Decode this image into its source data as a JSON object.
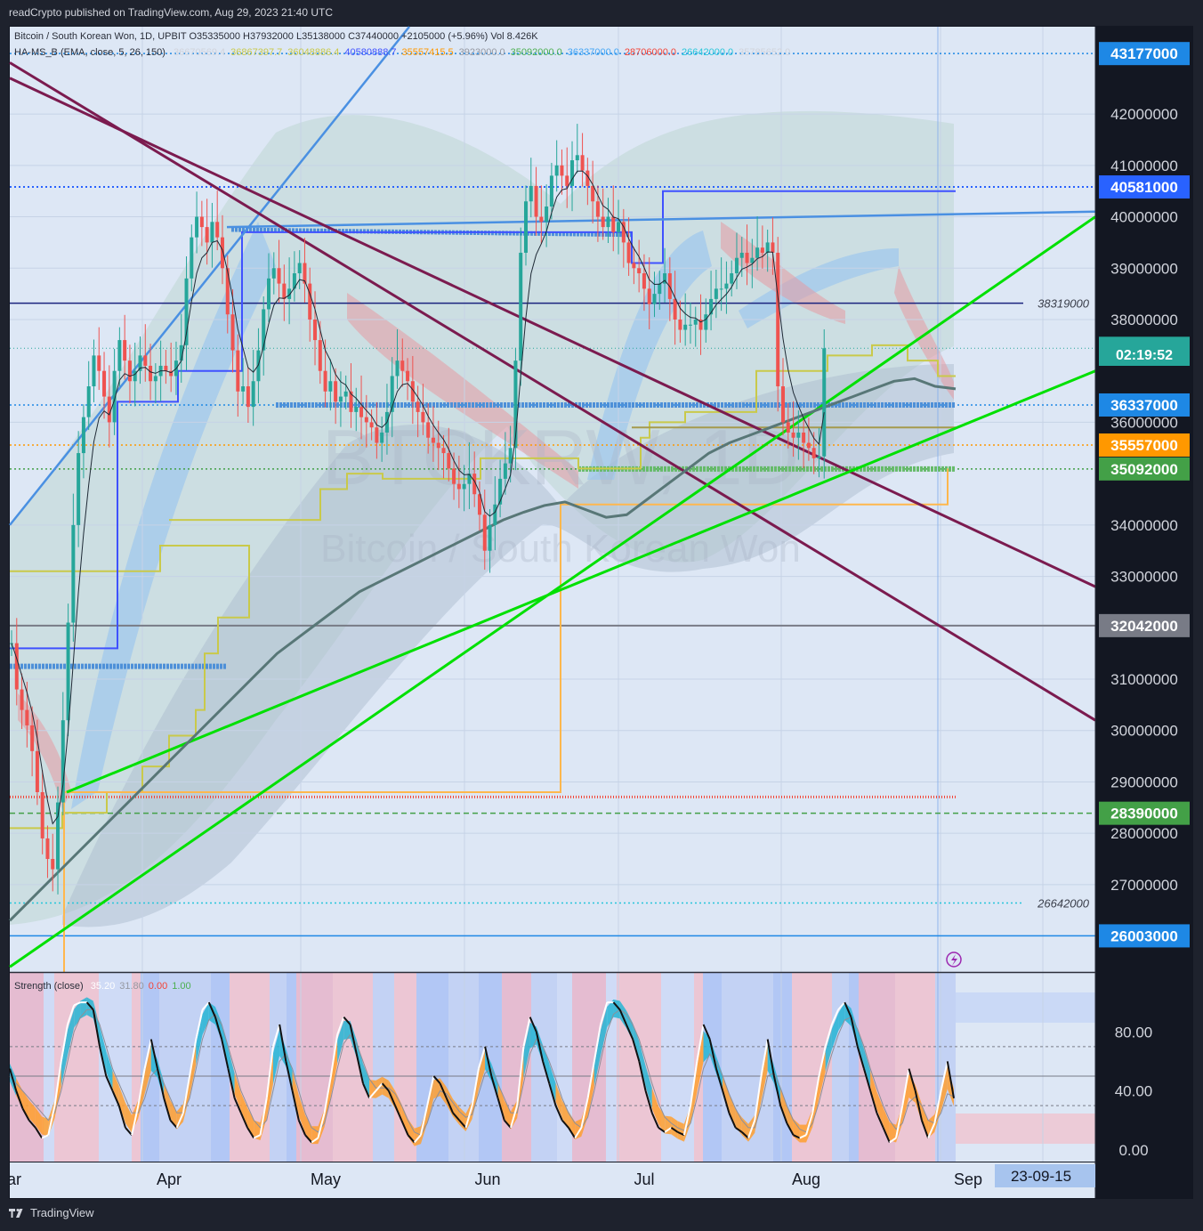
{
  "header": {
    "publisher_line": "readCrypto published on TradingView.com, Aug 29, 2023 21:40 UTC"
  },
  "footer": {
    "brand": "TradingView"
  },
  "legend": {
    "symbol_line": "Bitcoin / South Korean Won, 1D, UPBIT  O35335000 H37932000 L35138000 C37440000 +2105000 (+5.96%) Vol 8.426K",
    "indicator_name": "HA-MS_B (EMA, close, 5, 26, 150)",
    "indicator_values": [
      {
        "text": "36670569.4",
        "color": "#d1d4dc"
      },
      {
        "text": "36867397.7",
        "color": "#c9c94a"
      },
      {
        "text": "36048886.4",
        "color": "#c9c94a"
      },
      {
        "text": "40580888.7",
        "color": "#3f51ff"
      },
      {
        "text": "35557415.5",
        "color": "#ff9800"
      },
      {
        "text": "3923000.0",
        "color": "#9598a1"
      },
      {
        "text": "35092000.0",
        "color": "#4caf50"
      },
      {
        "text": "36337000.0",
        "color": "#42a5f5"
      },
      {
        "text": "28706000.0",
        "color": "#f44336"
      },
      {
        "text": "26642000.0",
        "color": "#26c6da"
      },
      {
        "text": "35785652.0",
        "color": "#d1d4dc"
      }
    ],
    "strength_name": "Strength (close)",
    "strength_values": [
      {
        "text": "35.20",
        "color": "#ffffff"
      },
      {
        "text": "31.80",
        "color": "#9598a1"
      },
      {
        "text": "0.00",
        "color": "#f44336"
      },
      {
        "text": "1.00",
        "color": "#4caf50"
      }
    ]
  },
  "watermark": {
    "ticker": "BTCKRW, 1D",
    "name": "Bitcoin / South Korean Won"
  },
  "chart_data": {
    "type": "candlestick",
    "symbol": "BTCKRW",
    "exchange": "UPBIT",
    "timeframe": "1D",
    "ohlc_last": {
      "open": 35335000,
      "high": 37932000,
      "low": 35138000,
      "close": 37440000,
      "change": 2105000,
      "change_pct": 5.96
    },
    "countdown": "02:19:52",
    "y_range": [
      25300000,
      43700000
    ],
    "y_ticks": [
      42000000,
      41000000,
      40000000,
      39000000,
      38000000,
      36000000,
      34000000,
      33000000,
      31000000,
      30000000,
      29000000,
      28000000,
      27000000
    ],
    "price_labels": [
      {
        "value": 43177000,
        "text": "43177000",
        "color": "#1e88e5"
      },
      {
        "value": 40581000,
        "text": "40581000",
        "color": "#2962ff"
      },
      {
        "value": 37440000,
        "text": "37440000",
        "color": "#26a69a"
      },
      {
        "value": 36337000,
        "text": "36337000",
        "color": "#1e88e5"
      },
      {
        "value": 35557000,
        "text": "35557000",
        "color": "#ff9800"
      },
      {
        "value": 35092000,
        "text": "35092000",
        "color": "#43a047"
      },
      {
        "value": 32042000,
        "text": "32042000",
        "color": "#787b86"
      },
      {
        "value": 28390000,
        "text": "28390000",
        "color": "#43a047"
      },
      {
        "value": 26003000,
        "text": "26003000",
        "color": "#1e88e5"
      }
    ],
    "level_annotations": [
      {
        "value": 38319000,
        "text": "38319000"
      },
      {
        "value": 26642000,
        "text": "26642000"
      }
    ],
    "x_labels": [
      "ar",
      "Apr",
      "May",
      "Jun",
      "Jul",
      "Aug",
      "Sep"
    ],
    "date_badge": "23-09-15",
    "closes": [
      31700000,
      30800000,
      30400000,
      30100000,
      29600000,
      28800000,
      27900000,
      27500000,
      27300000,
      28600000,
      30200000,
      32100000,
      34000000,
      35400000,
      36100000,
      36700000,
      37300000,
      37000000,
      36500000,
      36000000,
      37000000,
      37600000,
      37200000,
      36800000,
      37000000,
      37300000,
      37100000,
      36800000,
      36900000,
      37100000,
      37000000,
      36900000,
      37200000,
      37500000,
      38800000,
      39600000,
      40000000,
      39800000,
      39500000,
      39900000,
      39600000,
      39000000,
      38100000,
      37400000,
      36600000,
      36700000,
      36300000,
      36800000,
      37400000,
      38200000,
      38800000,
      39000000,
      38700000,
      38400000,
      38600000,
      38900000,
      39100000,
      38700000,
      38000000,
      37600000,
      37000000,
      36600000,
      36800000,
      36400000,
      36500000,
      36600000,
      36200000,
      36300000,
      36100000,
      36000000,
      35900000,
      35600000,
      35800000,
      36200000,
      36900000,
      37200000,
      37000000,
      36800000,
      36400000,
      36200000,
      36000000,
      35700000,
      35600000,
      35500000,
      35400000,
      35100000,
      34800000,
      34700000,
      34800000,
      35000000,
      34600000,
      34200000,
      33500000,
      34000000,
      34400000,
      34900000,
      35200000,
      35500000,
      37200000,
      39300000,
      40300000,
      40600000,
      40000000,
      39900000,
      40200000,
      40800000,
      41000000,
      40800000,
      40600000,
      41100000,
      41200000,
      40900000,
      40600000,
      40300000,
      40000000,
      39800000,
      40000000,
      39700000,
      39900000,
      39500000,
      39100000,
      39000000,
      38900000,
      38600000,
      38300000,
      38500000,
      38700000,
      38900000,
      38400000,
      38000000,
      37800000,
      37900000,
      37900000,
      38000000,
      37800000,
      38100000,
      38400000,
      38600000,
      38600000,
      38700000,
      38900000,
      39200000,
      39300000,
      39100000,
      39200000,
      39400000,
      39300000,
      39500000,
      39300000,
      36700000,
      36000000,
      35800000,
      35700000,
      35800000,
      35600000,
      35500000,
      35300000,
      35335000,
      37440000
    ],
    "ema_long": [
      26300000,
      26700000,
      27100000,
      27500000,
      27900000,
      28300000,
      28700000,
      29100000,
      29500000,
      29900000,
      30300000,
      30700000,
      31100000,
      31500000,
      31800000,
      32100000,
      32400000,
      32700000,
      32900000,
      33100000,
      33300000,
      33500000,
      33700000,
      33900000,
      34100000,
      34250000,
      34380000,
      34450000,
      34300000,
      34150000,
      34200000,
      34500000,
      34800000,
      35100000,
      35400000,
      35600000,
      35750000,
      35900000,
      36050000,
      36200000,
      36350000,
      36500000,
      36650000,
      36800000,
      36850000,
      36700000,
      36650000
    ],
    "strength_oscillator": {
      "y_range": [
        -8,
        120
      ],
      "y_ticks": [
        80,
        40,
        0
      ],
      "levels": [
        70,
        50,
        30
      ],
      "strength": [
        55,
        40,
        28,
        20,
        15,
        8,
        10,
        30,
        60,
        85,
        98,
        100,
        100,
        95,
        70,
        50,
        40,
        30,
        15,
        10,
        30,
        55,
        75,
        55,
        35,
        20,
        15,
        25,
        50,
        75,
        95,
        100,
        90,
        75,
        55,
        35,
        25,
        15,
        8,
        10,
        35,
        70,
        85,
        60,
        40,
        20,
        10,
        5,
        8,
        25,
        50,
        78,
        90,
        85,
        65,
        45,
        35,
        40,
        45,
        40,
        30,
        20,
        10,
        5,
        10,
        30,
        50,
        45,
        35,
        25,
        20,
        15,
        30,
        55,
        70,
        50,
        35,
        20,
        15,
        30,
        70,
        90,
        80,
        60,
        45,
        30,
        20,
        15,
        8,
        15,
        35,
        60,
        85,
        100,
        100,
        95,
        85,
        75,
        60,
        40,
        25,
        15,
        12,
        15,
        12,
        10,
        30,
        60,
        85,
        75,
        55,
        40,
        25,
        15,
        12,
        8,
        20,
        50,
        75,
        50,
        30,
        18,
        10,
        8,
        10,
        25,
        50,
        70,
        85,
        95,
        100,
        90,
        70,
        55,
        40,
        25,
        15,
        5,
        8,
        30,
        55,
        40,
        20,
        8,
        18,
        40,
        60,
        35
      ],
      "signal": [
        50,
        45,
        40,
        35,
        30,
        25,
        20,
        25,
        40,
        60,
        80,
        90,
        95,
        95,
        85,
        70,
        55,
        45,
        35,
        25,
        25,
        35,
        50,
        55,
        45,
        35,
        25,
        25,
        35,
        55,
        75,
        88,
        92,
        85,
        70,
        55,
        40,
        30,
        20,
        15,
        20,
        40,
        60,
        65,
        55,
        40,
        25,
        15,
        12,
        18,
        35,
        55,
        72,
        78,
        72,
        60,
        48,
        42,
        42,
        42,
        38,
        30,
        20,
        12,
        10,
        18,
        32,
        40,
        38,
        32,
        26,
        22,
        24,
        38,
        52,
        55,
        45,
        35,
        25,
        25,
        45,
        65,
        75,
        70,
        60,
        48,
        35,
        25,
        18,
        15,
        22,
        40,
        60,
        80,
        92,
        95,
        92,
        85,
        75,
        60,
        45,
        32,
        22,
        18,
        15,
        13,
        18,
        35,
        55,
        65,
        60,
        50,
        38,
        28,
        20,
        15,
        15,
        30,
        50,
        52,
        42,
        30,
        20,
        14,
        12,
        18,
        32,
        50,
        65,
        78,
        88,
        90,
        82,
        70,
        55,
        42,
        30,
        20,
        14,
        18,
        32,
        36,
        30,
        20,
        18,
        25,
        38,
        36
      ]
    }
  }
}
